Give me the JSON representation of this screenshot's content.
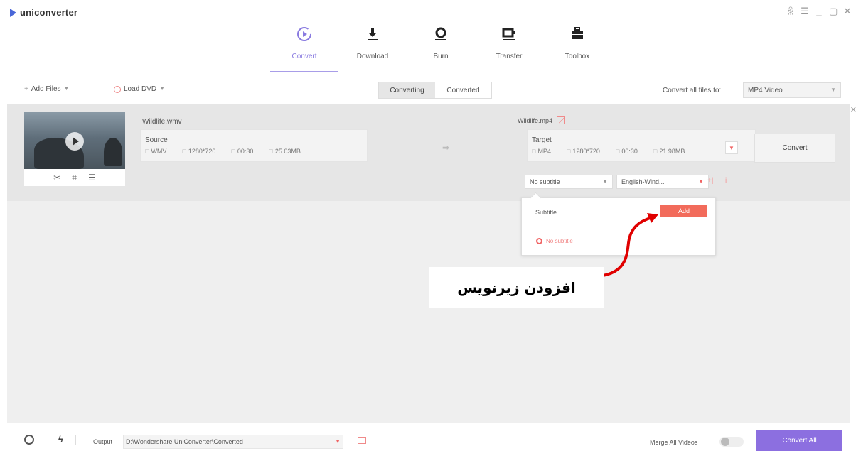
{
  "app": {
    "logo_text": "uniconverter"
  },
  "window_controls": [
    "ꆜ",
    "☰",
    "_",
    "▢",
    "✕"
  ],
  "nav": [
    {
      "label": "Convert",
      "icon": "convert-icon",
      "active": true
    },
    {
      "label": "Download",
      "icon": "download-icon",
      "active": false
    },
    {
      "label": "Burn",
      "icon": "burn-icon",
      "active": false
    },
    {
      "label": "Transfer",
      "icon": "transfer-icon",
      "active": false
    },
    {
      "label": "Toolbox",
      "icon": "toolbox-icon",
      "active": false
    }
  ],
  "toolbar": {
    "add_files": "Add Files",
    "load_dvd": "Load DVD",
    "tab_converting": "Converting",
    "tab_converted": "Converted",
    "convert_all_label": "Convert all files to:",
    "convert_all_value": "MP4 Video"
  },
  "file": {
    "source_name": "Wildlife.wmv",
    "source": {
      "title": "Source",
      "format": "WMV",
      "resolution": "1280*720",
      "duration": "00:30",
      "size": "25.03MB"
    },
    "target_name": "Wildlife.mp4",
    "target": {
      "title": "Target",
      "format": "MP4",
      "resolution": "1280*720",
      "duration": "00:30",
      "size": "21.98MB"
    },
    "convert_label": "Convert",
    "subtitle_value": "No subtitle",
    "audio_value": "English-Wind..."
  },
  "popup": {
    "label": "Subtitle",
    "add_label": "Add",
    "none_label": "No subtitle"
  },
  "annotation": {
    "text": "افزودن زیرنویس"
  },
  "bottom": {
    "output_label": "Output",
    "output_path": "D:\\Wondershare UniConverter\\Converted",
    "merge_label": "Merge All Videos",
    "convert_all_label": "Convert All"
  },
  "colors": {
    "accent": "#8c6fe0",
    "add_button": "#f26b5b",
    "annotation_arrow": "#e00000"
  }
}
